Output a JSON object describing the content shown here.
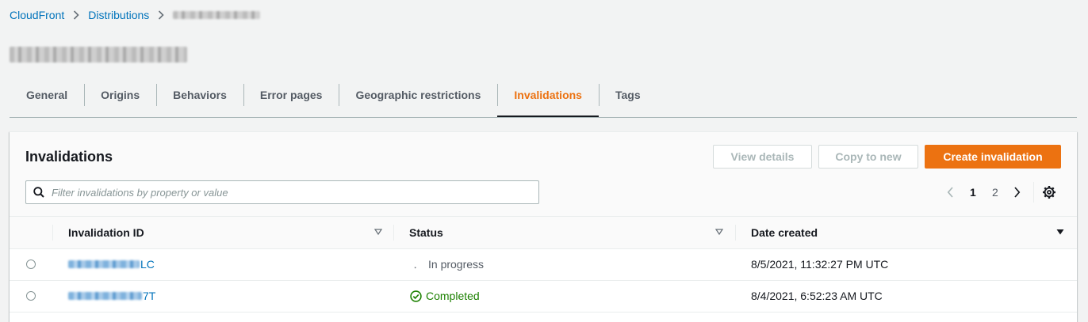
{
  "breadcrumb": {
    "items": [
      "CloudFront",
      "Distributions"
    ]
  },
  "tabs": [
    "General",
    "Origins",
    "Behaviors",
    "Error pages",
    "Geographic restrictions",
    "Invalidations",
    "Tags"
  ],
  "active_tab": "Invalidations",
  "panel": {
    "title": "Invalidations",
    "buttons": {
      "view": "View details",
      "copy": "Copy to new",
      "create": "Create invalidation"
    },
    "search_placeholder": "Filter invalidations by property or value",
    "pagination": {
      "current": "1",
      "next_page": "2"
    }
  },
  "table": {
    "columns": [
      "Invalidation ID",
      "Status",
      "Date created"
    ],
    "rows": [
      {
        "id_suffix": "LC",
        "status": "In progress",
        "date": "8/5/2021, 11:32:27 PM UTC"
      },
      {
        "id_suffix": "7T",
        "status": "Completed",
        "date": "8/4/2021, 6:52:23 AM UTC"
      }
    ]
  },
  "colors": {
    "accent": "#ec7211",
    "link": "#0073bb",
    "success": "#1d8102"
  },
  "icons": [
    "chevron-right-icon",
    "search-icon",
    "chevron-left-icon",
    "settings-gear-icon",
    "sort-icon",
    "sort-descending-icon",
    "spinner-icon",
    "check-circle-icon"
  ]
}
